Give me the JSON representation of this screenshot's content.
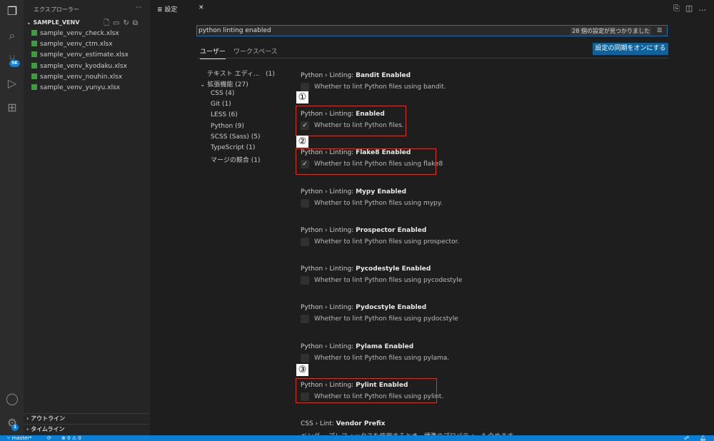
{
  "activity_bar": {
    "source_control_badge": "5K",
    "settings_badge": "1"
  },
  "explorer": {
    "title": "エクスプローラー",
    "more": "···",
    "folder": "SAMPLE_VENV",
    "files": [
      "sample_venv_check.xlsx",
      "sample_venv_ctm.xlsx",
      "sample_venv_estimate.xlsx",
      "sample_venv_kyodaku.xlsx",
      "sample_venv_nouhin.xlsx",
      "sample_venv_yunyu.xlsx"
    ],
    "outline": "アウトライン",
    "timeline": "タイムライン"
  },
  "tab": {
    "label": "設定",
    "close": "✕"
  },
  "search": {
    "value": "python linting enabled",
    "result_count": "28 個の設定が見つかりました"
  },
  "scope_tabs": [
    "ユーザー",
    "ワークスペース"
  ],
  "sync_button": "設定の同期をオンにする",
  "toc": [
    {
      "label": "テキスト エディ...",
      "count": "(1)"
    },
    {
      "label": "拡張機能",
      "count": "(27)"
    },
    {
      "label": "CSS",
      "count": "(4)"
    },
    {
      "label": "Git",
      "count": "(1)"
    },
    {
      "label": "LESS",
      "count": "(6)"
    },
    {
      "label": "Python",
      "count": "(9)"
    },
    {
      "label": "SCSS (Sass)",
      "count": "(5)"
    },
    {
      "label": "TypeScript",
      "count": "(1)"
    },
    {
      "label": "マージの競合",
      "count": "(1)"
    }
  ],
  "settings": [
    {
      "prefix": "Python › Linting: ",
      "name": "Bandit Enabled",
      "desc": "Whether to lint Python files using bandit.",
      "checked": false
    },
    {
      "prefix": "Python › Linting: ",
      "name": "Enabled",
      "desc": "Whether to lint Python files.",
      "checked": true
    },
    {
      "prefix": "Python › Linting: ",
      "name": "Flake8 Enabled",
      "desc": "Whether to lint Python files using flake8",
      "checked": true
    },
    {
      "prefix": "Python › Linting: ",
      "name": "Mypy Enabled",
      "desc": "Whether to lint Python files using mypy.",
      "checked": false
    },
    {
      "prefix": "Python › Linting: ",
      "name": "Prospector Enabled",
      "desc": "Whether to lint Python files using prospector.",
      "checked": false
    },
    {
      "prefix": "Python › Linting: ",
      "name": "Pycodestyle Enabled",
      "desc": "Whether to lint Python files using pycodestyle",
      "checked": false
    },
    {
      "prefix": "Python › Linting: ",
      "name": "Pydocstyle Enabled",
      "desc": "Whether to lint Python files using pydocstyle",
      "checked": false
    },
    {
      "prefix": "Python › Linting: ",
      "name": "Pylama Enabled",
      "desc": "Whether to lint Python files using pylama.",
      "checked": false
    },
    {
      "prefix": "Python › Linting: ",
      "name": "Pylint Enabled",
      "desc": "Whether to lint Python files using pylint.",
      "checked": false
    },
    {
      "prefix": "CSS › Lint: ",
      "name": "Vendor Prefix",
      "desc": "ベンダー プレフィックスを使用するとき、標準のプロパティーも含めます。"
    }
  ],
  "annotations": [
    "①",
    "②",
    "③"
  ],
  "statusbar": {
    "branch": "master*",
    "errors": "0",
    "warnings": "0"
  },
  "colors": {
    "accent": "#0b7fd4",
    "annotation_box": "#d2392b"
  }
}
